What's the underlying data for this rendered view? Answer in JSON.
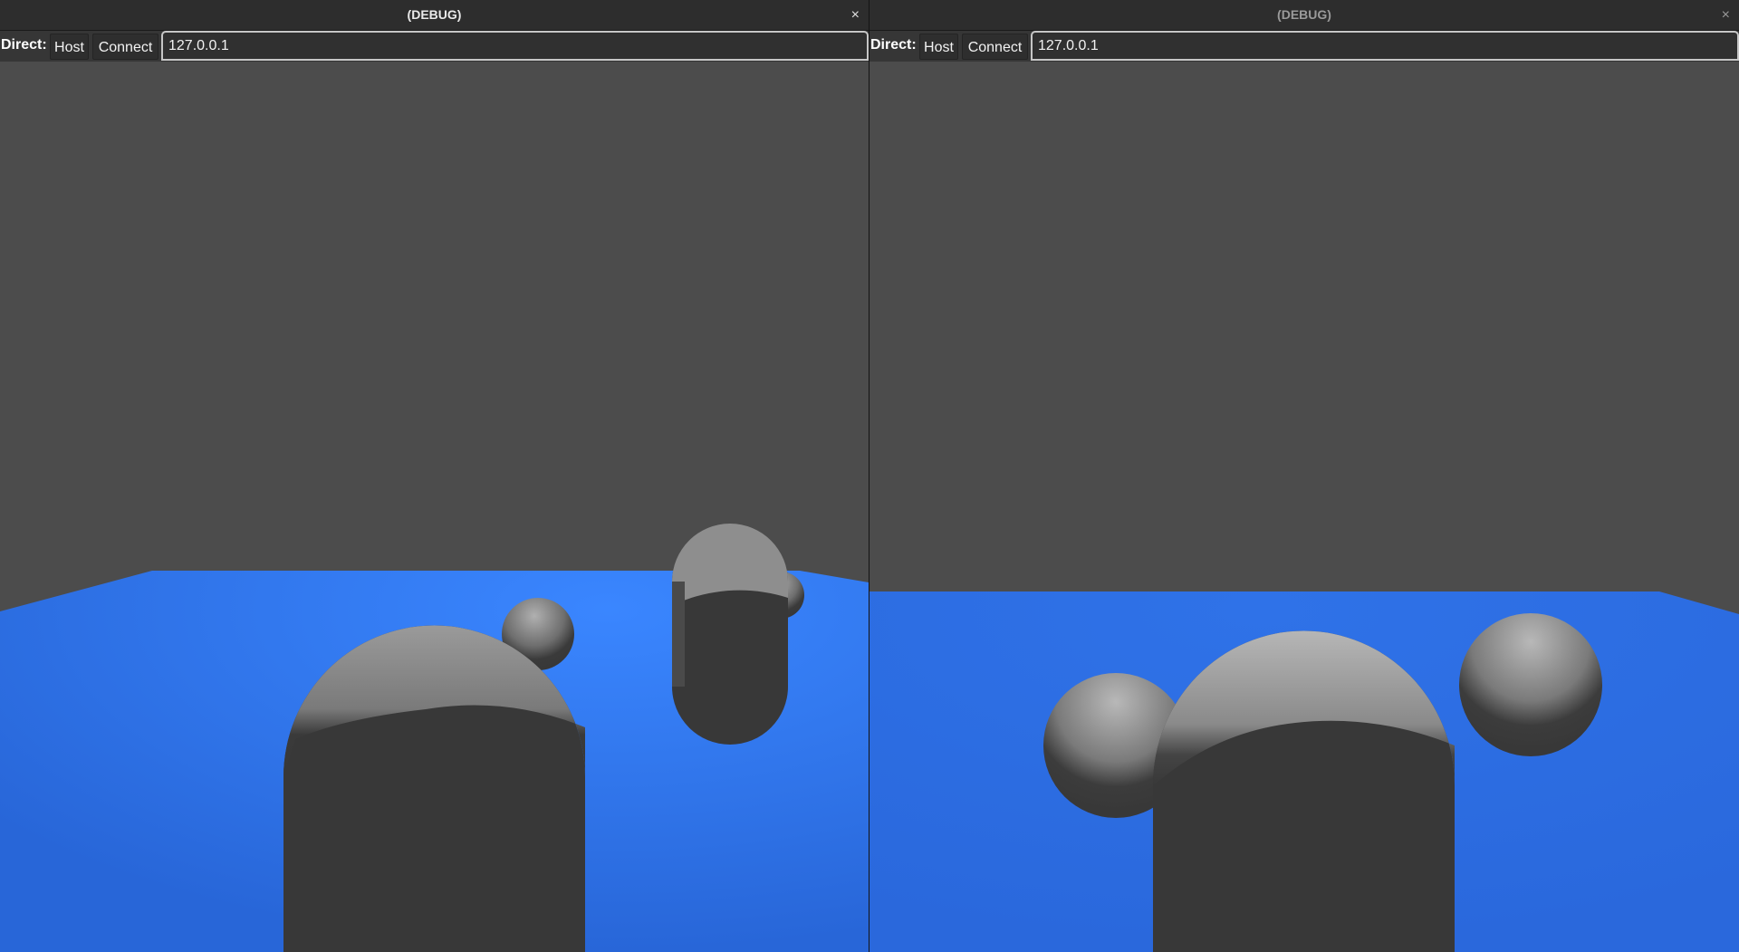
{
  "windows": [
    {
      "title": "(DEBUG)",
      "close_symbol": "×",
      "toolbar": {
        "label": "Direct:",
        "host_label": "Host",
        "connect_label": "Connect",
        "address": "127.0.0.1"
      }
    },
    {
      "title": "(DEBUG)",
      "close_symbol": "×",
      "toolbar": {
        "label": "Direct:",
        "host_label": "Host",
        "connect_label": "Connect",
        "address": "127.0.0.1"
      }
    }
  ],
  "colors": {
    "sky": "#4c4c4c",
    "floor": "#2f78f2",
    "object_light": "#a8a8a8",
    "object_dark": "#383838"
  }
}
